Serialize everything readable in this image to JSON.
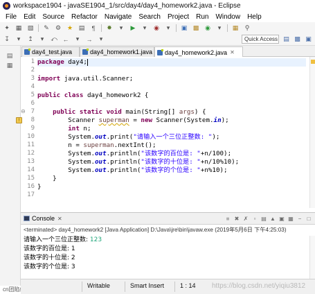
{
  "window": {
    "title": "workspace1904 - javaSE1904_1/src/day4/day4_homework2.java - Eclipse"
  },
  "menu": [
    "File",
    "Edit",
    "Source",
    "Refactor",
    "Navigate",
    "Search",
    "Project",
    "Run",
    "Window",
    "Help"
  ],
  "toolbar": {
    "quick_access": "Quick Access"
  },
  "tabs": [
    {
      "label": "day4_test.java",
      "active": false
    },
    {
      "label": "day4_homework1.java",
      "active": false
    },
    {
      "label": "day4_homework2.java",
      "active": true
    }
  ],
  "editor": {
    "line_numbers": [
      "1",
      "2",
      "3",
      "4",
      "5",
      "6",
      "7",
      "8",
      "9",
      "10",
      "11",
      "12",
      "13",
      "14",
      "15",
      "16",
      "17"
    ],
    "lines": {
      "l1": {
        "kw": "package",
        "rest": " day4;"
      },
      "l3": {
        "kw": "import",
        "rest": " java.util.Scanner;"
      },
      "l5": {
        "kw1": "public",
        "kw2": "class",
        "rest": " day4_homework2 {"
      },
      "l7": {
        "kw1": "public",
        "kw2": "static",
        "kw3": "void",
        "rest": " main(String[] ",
        "var": "args",
        "end": ") {"
      },
      "l8": {
        "pre": "Scanner ",
        "var": "superman",
        "mid": " = ",
        "kw": "new",
        "post": " Scanner(System.",
        "fld": "in",
        "end": ");"
      },
      "l9": {
        "kw": "int",
        "rest": " n;"
      },
      "l10": {
        "pre": "System.",
        "fld": "out",
        "mid": ".print(",
        "str": "\"请输入一个三位正整数: \"",
        "end": ");"
      },
      "l11": {
        "pre": "n = ",
        "var": "superman",
        "end": ".nextInt();"
      },
      "l12": {
        "pre": "System.",
        "fld": "out",
        "mid": ".println(",
        "str": "\"该数字的百位是: \"",
        "end": "+n/100);"
      },
      "l13": {
        "pre": "System.",
        "fld": "out",
        "mid": ".println(",
        "str": "\"该数字的十位是: \"",
        "end": "+n/10%10);"
      },
      "l14": {
        "pre": "System.",
        "fld": "out",
        "mid": ".println(",
        "str": "\"该数字的个位是: \"",
        "end": "+n%10);"
      },
      "l15": {
        "text": "}"
      },
      "l16": {
        "text": "}"
      }
    }
  },
  "console": {
    "tab_label": "Console",
    "terminated": "<terminated> day4_homework2 [Java Application] D:\\Java\\jre\\bin\\javaw.exe (2019年5月6日 下午4:25:03)",
    "prompt": "请输入一个三位正整数: ",
    "input": "123",
    "out1": "该数字的百位是: 1",
    "out2": "该数字的十位是: 2",
    "out3": "该数字的个位是: 3"
  },
  "status": {
    "writable": "Writable",
    "insert_mode": "Smart Insert",
    "position": "1 : 14",
    "watermark": "https://blog.csdn.net/yiqiu3812"
  },
  "bottom_hint": "cn团陷纤奴"
}
